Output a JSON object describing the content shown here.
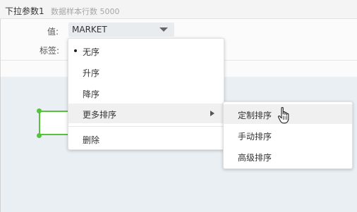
{
  "header": {
    "title": "下拉参数1",
    "row_count": "数据样本行数 5000"
  },
  "form": {
    "value_label": "值:",
    "value_selected": "MARKET",
    "tag_label": "标签:"
  },
  "sort_menu": {
    "items": [
      {
        "label": "无序",
        "selected": true
      },
      {
        "label": "升序"
      },
      {
        "label": "降序"
      },
      {
        "label": "更多排序",
        "has_submenu": true
      },
      {
        "label": "删除"
      }
    ]
  },
  "submenu": {
    "items": [
      {
        "label": "定制排序"
      },
      {
        "label": "手动排序"
      },
      {
        "label": "高级排序"
      }
    ]
  },
  "colors": {
    "selection_green": "#56c43a",
    "canvas_bg": "#e9eff3"
  }
}
